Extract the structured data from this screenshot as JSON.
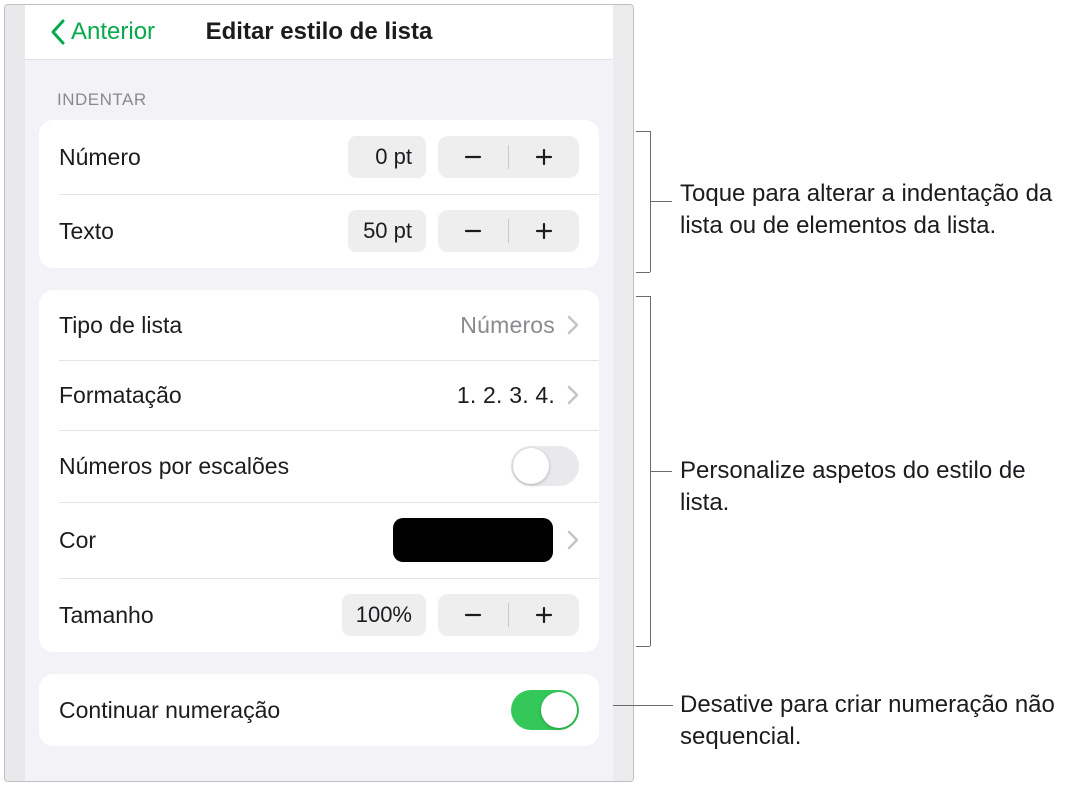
{
  "header": {
    "back_label": "Anterior",
    "title": "Editar estilo de lista"
  },
  "indent_section": {
    "header": "INDENTAR",
    "rows": {
      "number": {
        "label": "Número",
        "value": "0 pt"
      },
      "text": {
        "label": "Texto",
        "value": "50 pt"
      }
    }
  },
  "customize_section": {
    "rows": {
      "list_type": {
        "label": "Tipo de lista",
        "value": "Números"
      },
      "format": {
        "label": "Formatação",
        "value": "1. 2. 3. 4."
      },
      "tiered": {
        "label": "Números por escalões",
        "on": false
      },
      "color": {
        "label": "Cor",
        "hex": "#000000"
      },
      "size": {
        "label": "Tamanho",
        "value": "100%"
      }
    }
  },
  "continue_section": {
    "row": {
      "label": "Continuar numeração",
      "on": true
    }
  },
  "callouts": {
    "indent": "Toque para alterar a indentação da lista ou de elementos da lista.",
    "customize": "Personalize aspetos do estilo de lista.",
    "continue": "Desative para criar numeração não sequencial."
  }
}
